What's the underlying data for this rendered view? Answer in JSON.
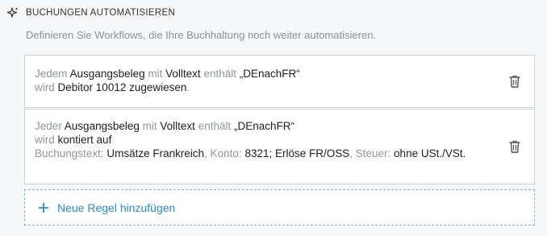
{
  "section": {
    "title": "BUCHUNGEN AUTOMATISIEREN",
    "subtitle": "Definieren Sie Workflows, die Ihre Buchhaltung noch weiter automatisieren."
  },
  "rules": [
    {
      "w1": "Jedem",
      "w2": "Ausgangsbeleg",
      "w3": "mit",
      "w4": "Volltext",
      "w5": "enthält",
      "w6": "„DEnachFR“",
      "w7": "wird",
      "w8": "Debitor 10012 zugewiesen",
      "w9": "."
    },
    {
      "w1": "Jeder",
      "w2": "Ausgangsbeleg",
      "w3": "mit",
      "w4": "Volltext",
      "w5": "enthält",
      "w6": "„DEnachFR“",
      "w7": "wird",
      "w8": "kontiert auf",
      "w9": "Buchungstext:",
      "w10": "Umsätze Frankreich",
      "w11": ", Konto:",
      "w12": "8321; Erlöse FR/OSS",
      "w13": ", Steuer:",
      "w14": "ohne USt./VSt."
    }
  ],
  "add_rule": {
    "label": "Neue Regel hinzufügen"
  },
  "colors": {
    "accent": "#2a8ad1",
    "keyword": "#8f979f",
    "border": "#cfd4d9"
  },
  "icons": {
    "header": "sparkle-icon",
    "delete": "trash-icon",
    "add": "plus-icon"
  }
}
